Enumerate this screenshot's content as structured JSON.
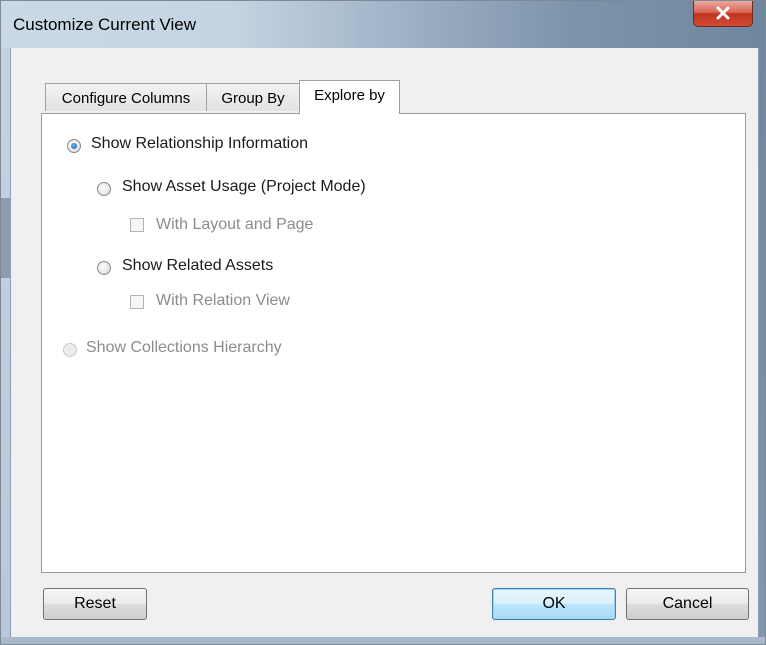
{
  "window": {
    "title": "Customize Current View",
    "close_glyph": "x"
  },
  "tabs": [
    {
      "label": "Configure Columns",
      "active": false
    },
    {
      "label": "Group By",
      "active": false
    },
    {
      "label": "Explore by",
      "active": true
    }
  ],
  "options": {
    "show_relationship": {
      "label": "Show Relationship Information",
      "checked": true,
      "enabled": true
    },
    "show_asset_usage": {
      "label": "Show Asset Usage (Project Mode)",
      "checked": false,
      "enabled": true
    },
    "with_layout_and_page": {
      "label": "With Layout and Page",
      "checked": false,
      "enabled": false
    },
    "show_related_assets": {
      "label": "Show Related Assets",
      "checked": false,
      "enabled": true
    },
    "with_relation_view": {
      "label": "With Relation View",
      "checked": false,
      "enabled": false
    },
    "show_collections_hierarchy": {
      "label": "Show Collections Hierarchy",
      "checked": false,
      "enabled": false
    }
  },
  "buttons": {
    "reset": "Reset",
    "ok": "OK",
    "cancel": "Cancel"
  },
  "colors": {
    "radio_selected": "#2c73c2",
    "close_button": "#c2341f",
    "disabled_text": "#8c8c8c"
  }
}
